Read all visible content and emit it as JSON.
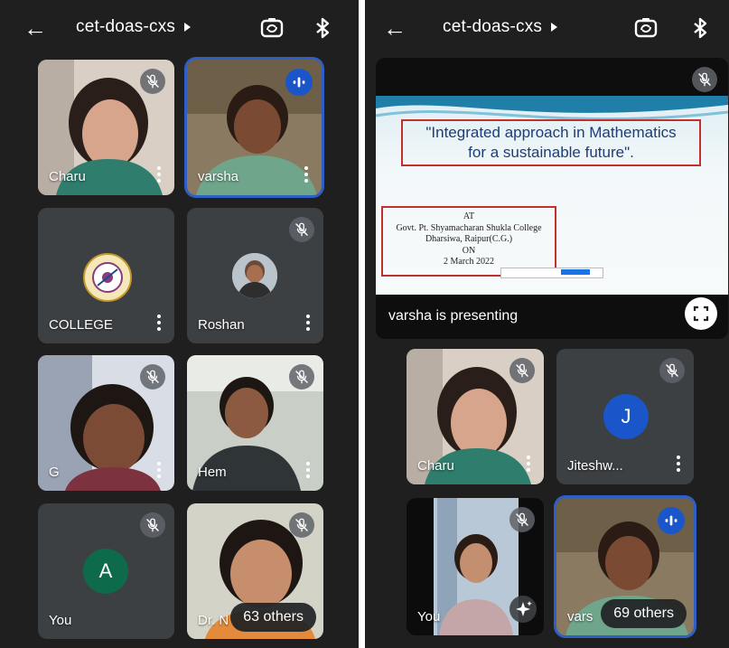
{
  "left": {
    "header": {
      "title": "cet-doas-cxs"
    },
    "tiles": [
      {
        "name": "Charu"
      },
      {
        "name": "varsha"
      },
      {
        "name": "COLLEGE"
      },
      {
        "name": "Roshan"
      },
      {
        "name": "G"
      },
      {
        "name": "Hem"
      },
      {
        "name": "You",
        "avatar_letter": "A"
      },
      {
        "name": "Dr. N",
        "others": "63 others"
      }
    ]
  },
  "right": {
    "header": {
      "title": "cet-doas-cxs"
    },
    "presentation": {
      "slide_title_line1": "\"Integrated approach in Mathematics",
      "slide_title_line2": "for a sustainable future\".",
      "slide_info": [
        "AT",
        "Govt. Pt. Shyamacharan Shukla College",
        "Dharsiwa, Raipur(C.G.)",
        "ON",
        "2 March  2022"
      ],
      "presenting_label": "varsha is presenting"
    },
    "tiles": [
      {
        "name": "Charu"
      },
      {
        "name": "Jiteshw...",
        "avatar_letter": "J"
      },
      {
        "name": "You"
      },
      {
        "name": "vars",
        "others": "69 others"
      }
    ]
  },
  "colors": {
    "background": "#1f1f1f",
    "tile": "#3c4043",
    "speaking_accent": "#1a55c9",
    "you_avatar": "#0d6b4c",
    "j_avatar": "#1a55c9",
    "slide_border": "#c0312c"
  },
  "icons": [
    "arrow-back-icon",
    "caret-right-icon",
    "switch-camera-icon",
    "bluetooth-icon",
    "mic-off-icon",
    "audio-level-icon",
    "more-vert-icon",
    "fullscreen-icon",
    "sparkle-icon"
  ]
}
